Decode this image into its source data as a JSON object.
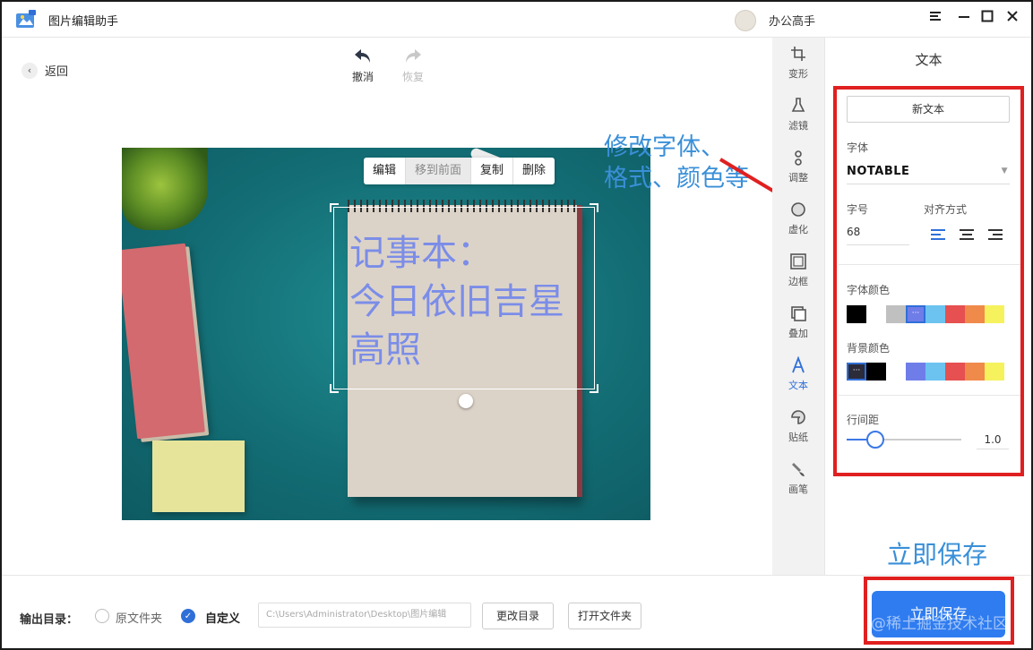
{
  "app": {
    "title": "图片编辑助手",
    "user_name": "办公高手"
  },
  "toolbar": {
    "back_label": "返回",
    "undo_label": "撤消",
    "redo_label": "恢复"
  },
  "float_menu": {
    "edit": "编辑",
    "move_front": "移到前面",
    "copy": "复制",
    "delete": "删除"
  },
  "photo_text": {
    "line1": "记事本：",
    "line2": "今日依旧吉星",
    "line3": "高照",
    "color": "#7b8de8"
  },
  "annotations": {
    "modify_line1": "修改字体、",
    "modify_line2": "格式、颜色等",
    "save_hint": "立即保存"
  },
  "tools": [
    {
      "label": "变形",
      "icon": "crop-icon"
    },
    {
      "label": "滤镜",
      "icon": "flask-icon"
    },
    {
      "label": "调整",
      "icon": "sliders-icon"
    },
    {
      "label": "虚化",
      "icon": "blur-icon"
    },
    {
      "label": "边框",
      "icon": "frame-icon"
    },
    {
      "label": "叠加",
      "icon": "layers-icon"
    },
    {
      "label": "文本",
      "icon": "text-icon",
      "active": true
    },
    {
      "label": "贴纸",
      "icon": "sticker-icon"
    },
    {
      "label": "画笔",
      "icon": "brush-icon"
    }
  ],
  "panel": {
    "title": "文本",
    "new_text_label": "新文本",
    "font_label": "字体",
    "font_value": "NOTABLE",
    "size_label": "字号",
    "size_value": "68",
    "align_label": "对齐方式",
    "font_color_label": "字体颜色",
    "font_colors": [
      "#000000",
      "#ffffff",
      "#c0c0c0",
      "#6f7de8",
      "#6cc3f0",
      "#e65050",
      "#f08a4b",
      "#f5f25e"
    ],
    "bg_color_label": "背景颜色",
    "bg_colors": [
      "#2b2b3a",
      "#000000",
      "#ffffff",
      "#6f7de8",
      "#6cc3f0",
      "#e65050",
      "#f08a4b",
      "#f5f25e"
    ],
    "line_spacing_label": "行间距",
    "line_spacing_value": "1.0",
    "line_spacing_level": 0.25
  },
  "bottom": {
    "output_label": "输出目录：",
    "option_original": "原文件夹",
    "option_custom": "自定义",
    "path_value": "C:\\Users\\Administrator\\Desktop\\图片编辑",
    "change_dir_label": "更改目录",
    "open_folder_label": "打开文件夹",
    "save_label": "立即保存"
  },
  "watermark": "@稀土掘金技术社区",
  "colors": {
    "accent": "#2f7cf0",
    "annotation": "#3a8fd8",
    "highlight_red": "#e02020"
  }
}
